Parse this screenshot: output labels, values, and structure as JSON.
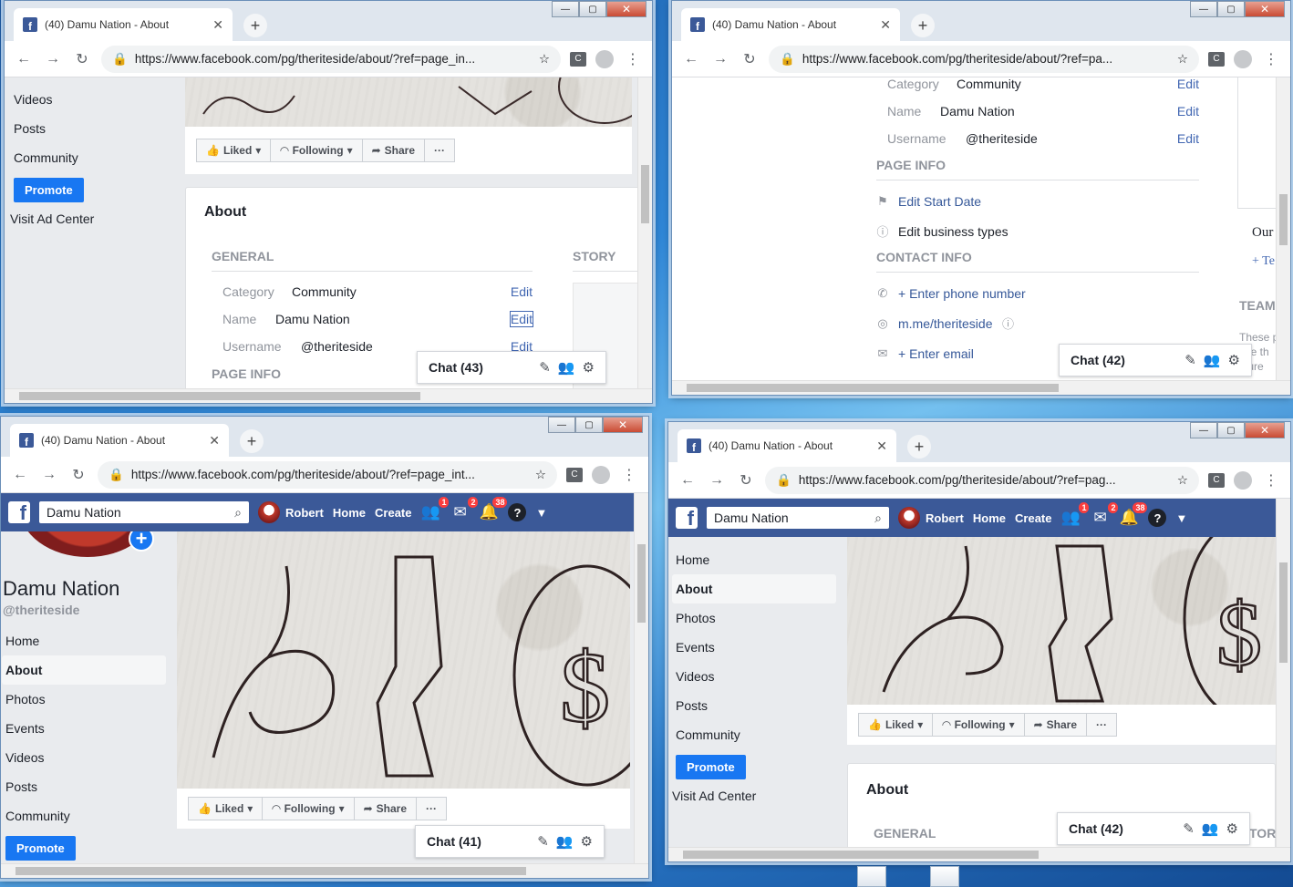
{
  "tab_title_1": "(40) Damu Nation - About",
  "tab_title_2": "(40) Damu Nation - About",
  "tab_title_3": "(40) Damu Nation - About",
  "tab_title_4": "(40) Damu Nation - About",
  "urls": {
    "w1": "https://www.facebook.com/pg/theriteside/about/?ref=page_in...",
    "w2": "https://www.facebook.com/pg/theriteside/about/?ref=pa...",
    "w3": "https://www.facebook.com/pg/theriteside/about/?ref=page_int...",
    "w4": "https://www.facebook.com/pg/theriteside/about/?ref=pag..."
  },
  "window_controls": {
    "minimize": "—",
    "maximize": "▢",
    "close": "✕"
  },
  "fb_header": {
    "search_value": "Damu Nation",
    "user_name": "Robert",
    "home": "Home",
    "create": "Create",
    "friend_badge": "1",
    "messages_badge": "2",
    "notifications_badge": "38",
    "help": "?"
  },
  "page": {
    "name": "Damu Nation",
    "username": "@theriteside"
  },
  "nav": {
    "home": "Home",
    "about": "About",
    "photos": "Photos",
    "events": "Events",
    "videos": "Videos",
    "posts": "Posts",
    "community": "Community",
    "promote": "Promote",
    "ad_center": "Visit Ad Center"
  },
  "actions": {
    "liked": "Liked",
    "following": "Following",
    "share": "Share",
    "more": "···"
  },
  "about": {
    "title": "About",
    "general": "GENERAL",
    "story": "STORY",
    "story_cut": "TORY",
    "category_label": "Category",
    "category_value": "Community",
    "name_label": "Name",
    "name_value": "Damu Nation",
    "username_label": "Username",
    "username_value": "@theriteside",
    "edit": "Edit",
    "page_info": "PAGE INFO",
    "edit_start_date": "Edit Start Date",
    "edit_business_types": "Edit business types",
    "contact_info": "CONTACT INFO",
    "enter_phone": "+ Enter phone number",
    "messenger": "m.me/theriteside",
    "enter_email": "+ Enter email",
    "side_our": "Our",
    "side_plus": "+ Te",
    "side_team": "TEAM",
    "side_these": "These p",
    "side_ave": "ave th",
    "side_cture": "cture"
  },
  "chat": {
    "w1": "Chat (43)",
    "w2": "Chat (42)",
    "w3": "Chat (41)",
    "w4": "Chat (42)"
  },
  "colors": {
    "fb_blue": "#3b5998",
    "link": "#4267b2",
    "promote": "#1877f2"
  }
}
